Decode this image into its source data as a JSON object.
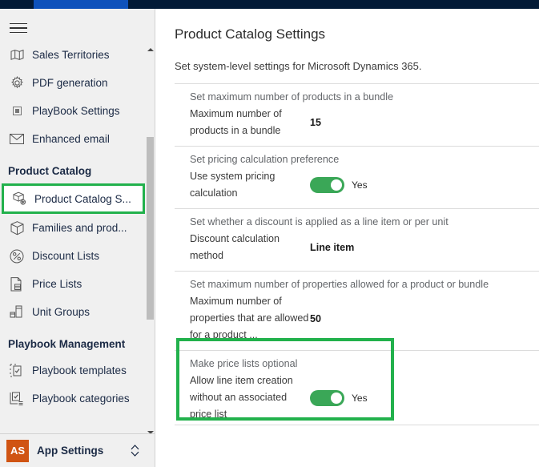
{
  "topbar": {
    "active_tab": ""
  },
  "sidebar": {
    "menu_icon": "hamburger-icon",
    "items": [
      {
        "label": "Sales Territories",
        "icon": "map-icon",
        "type": "item",
        "selected": false
      },
      {
        "label": "PDF generation",
        "icon": "gear-icon",
        "type": "item",
        "selected": false
      },
      {
        "label": "PlayBook Settings",
        "icon": "small-square-icon",
        "type": "item",
        "selected": false
      },
      {
        "label": "Enhanced email",
        "icon": "envelope-icon",
        "type": "item",
        "selected": false
      },
      {
        "label": "Product Catalog",
        "type": "section"
      },
      {
        "label": "Product Catalog S...",
        "icon": "product-catalog-settings-icon",
        "type": "item",
        "selected": true
      },
      {
        "label": "Families and prod...",
        "icon": "box-icon",
        "type": "item",
        "selected": false
      },
      {
        "label": "Discount Lists",
        "icon": "percent-circle-icon",
        "type": "item",
        "selected": false
      },
      {
        "label": "Price Lists",
        "icon": "price-list-icon",
        "type": "item",
        "selected": false
      },
      {
        "label": "Unit Groups",
        "icon": "unit-groups-icon",
        "type": "item",
        "selected": false
      },
      {
        "label": "Playbook Management",
        "type": "section"
      },
      {
        "label": "Playbook templates",
        "icon": "playbook-template-icon",
        "type": "item",
        "selected": false
      },
      {
        "label": "Playbook categories",
        "icon": "playbook-category-icon",
        "type": "item",
        "selected": false
      }
    ],
    "footer": {
      "badge": "AS",
      "label": "App Settings",
      "chevron_icon": "chevron-updown-icon"
    },
    "scrollbar": {
      "up_icon": "caret-up-icon",
      "down_icon": "caret-down-icon"
    }
  },
  "main": {
    "title": "Product Catalog Settings",
    "subtitle": "Set system-level settings for Microsoft Dynamics 365.",
    "settings": [
      {
        "description": "Set maximum number of products in a bundle",
        "label": "Maximum number of products in a bundle",
        "value": "15",
        "control": "text"
      },
      {
        "description": "Set pricing calculation preference",
        "label": "Use system pricing calculation",
        "value": "Yes",
        "control": "toggle",
        "toggle_on": true
      },
      {
        "description": "Set whether a discount is applied as a line item or per unit",
        "label": "Discount calculation method",
        "value": "Line item",
        "control": "text"
      },
      {
        "description": "Set maximum number of properties allowed for a product or bundle",
        "label": "Maximum number of properties that are allowed for a product ...",
        "value": "50",
        "control": "text"
      },
      {
        "description": "Make price lists optional",
        "label": "Allow line item creation without an associated price list",
        "value": "Yes",
        "control": "toggle",
        "toggle_on": true,
        "highlighted": true
      }
    ]
  },
  "colors": {
    "topbar_dark": "#021a36",
    "topbar_active": "#0e52bb",
    "sidebar_bg": "#f0f0f0",
    "highlight_green": "#22b14c",
    "toggle_green": "#3aa757",
    "badge_orange": "#d05413"
  }
}
